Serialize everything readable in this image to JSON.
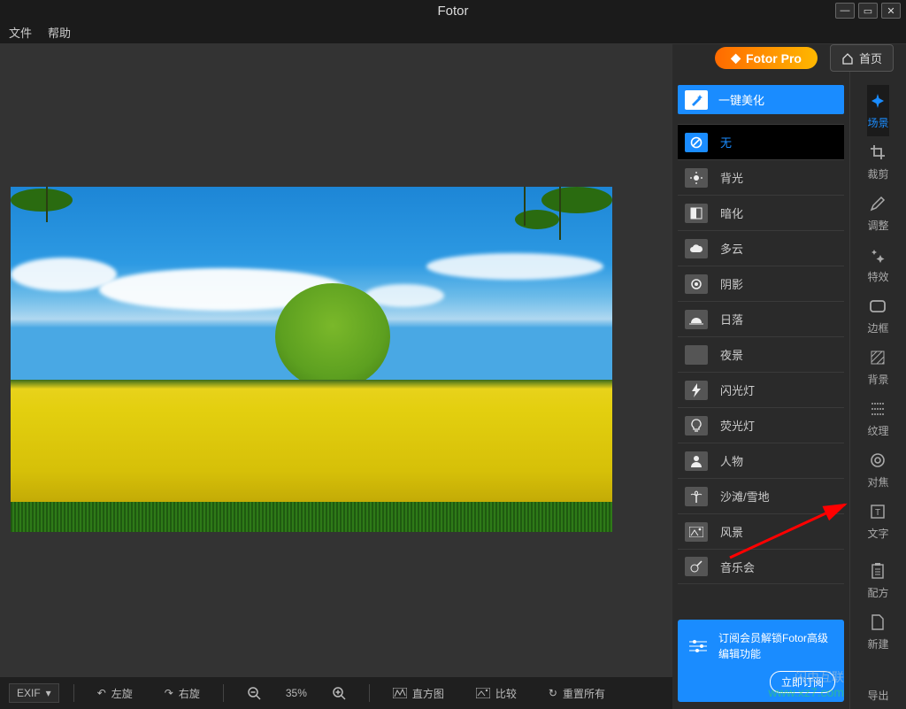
{
  "app": {
    "title": "Fotor"
  },
  "menu": {
    "file": "文件",
    "help": "帮助"
  },
  "window": {
    "min": "—",
    "max": "▭",
    "close": "✕"
  },
  "topbar": {
    "pro_label": "Fotor Pro",
    "home_label": "首页"
  },
  "scenes": {
    "header": "一键美化",
    "items": [
      {
        "key": "none",
        "label": "无",
        "icon": "none-icon",
        "selected": true
      },
      {
        "key": "backlight",
        "label": "背光",
        "icon": "backlight-icon",
        "selected": false
      },
      {
        "key": "darken",
        "label": "暗化",
        "icon": "darken-icon",
        "selected": false
      },
      {
        "key": "cloudy",
        "label": "多云",
        "icon": "cloud-icon",
        "selected": false
      },
      {
        "key": "shadow",
        "label": "阴影",
        "icon": "shadow-icon",
        "selected": false
      },
      {
        "key": "sunset",
        "label": "日落",
        "icon": "sunset-icon",
        "selected": false
      },
      {
        "key": "night",
        "label": "夜景",
        "icon": "moon-icon",
        "selected": false
      },
      {
        "key": "flash",
        "label": "闪光灯",
        "icon": "flash-icon",
        "selected": false
      },
      {
        "key": "fluorescent",
        "label": "荧光灯",
        "icon": "bulb-icon",
        "selected": false
      },
      {
        "key": "portrait",
        "label": "人物",
        "icon": "person-icon",
        "selected": false
      },
      {
        "key": "beach",
        "label": "沙滩/雪地",
        "icon": "palm-icon",
        "selected": false
      },
      {
        "key": "landscape",
        "label": "风景",
        "icon": "landscape-icon",
        "selected": false
      },
      {
        "key": "concert",
        "label": "音乐会",
        "icon": "guitar-icon",
        "selected": false
      }
    ]
  },
  "promo": {
    "text": "订阅会员解锁Fotor高级编辑功能",
    "cta": "立即订阅"
  },
  "rail": {
    "items": [
      {
        "key": "scene",
        "label": "场景",
        "icon": "sparkle-icon",
        "active": true
      },
      {
        "key": "crop",
        "label": "裁剪",
        "icon": "crop-icon",
        "active": false
      },
      {
        "key": "adjust",
        "label": "调整",
        "icon": "pencil-icon",
        "active": false
      },
      {
        "key": "effect",
        "label": "特效",
        "icon": "stars-icon",
        "active": false
      },
      {
        "key": "border",
        "label": "边框",
        "icon": "rect-icon",
        "active": false
      },
      {
        "key": "bg",
        "label": "背景",
        "icon": "hatch-icon",
        "active": false
      },
      {
        "key": "texture",
        "label": "纹理",
        "icon": "grid-icon",
        "active": false
      },
      {
        "key": "focus",
        "label": "对焦",
        "icon": "target-icon",
        "active": false
      },
      {
        "key": "text",
        "label": "文字",
        "icon": "text-icon",
        "active": false
      }
    ],
    "bottom": [
      {
        "key": "recipe",
        "label": "配方",
        "icon": "clipboard-icon"
      },
      {
        "key": "new",
        "label": "新建",
        "icon": "file-icon"
      },
      {
        "key": "export",
        "label": "导出",
        "icon": ""
      }
    ]
  },
  "bottombar": {
    "exif": "EXIF",
    "rotate_left": "左旋",
    "rotate_right": "右旋",
    "zoom": "35%",
    "histogram": "直方图",
    "compare": "比较",
    "reset": "重置所有"
  },
  "watermark": {
    "line1": "闪由互联",
    "line2": "www.xz7.com"
  }
}
